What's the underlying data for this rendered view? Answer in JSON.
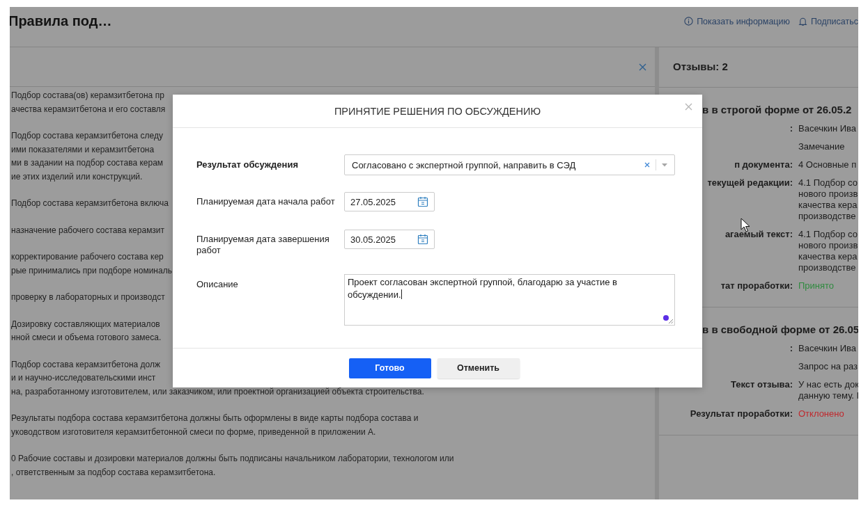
{
  "page": {
    "title": "Правила под…",
    "actions": [
      {
        "kind": "info",
        "label": "Показать информацию"
      },
      {
        "kind": "bell",
        "label": "Подписатьс"
      }
    ]
  },
  "document": {
    "paragraphs": [
      [
        "Подбор состава(ов) керамзитбетона пр",
        "ачества керамзитбетона и его составля"
      ],
      [
        "Подбор состава керамзитбетона следу",
        "ими показателями и керамзитбетона",
        "ми в задании на подбор состава керам",
        "ие этих изделий или конструкций."
      ],
      [
        "Подбор состава керамзитбетона включа"
      ],
      [
        "назначение рабочего состава керамзит"
      ],
      [
        "корректирование рабочего состава кер",
        "рые принимались при подборе номиналь"
      ],
      [
        "проверку в лабораторных и производст"
      ],
      [
        "Дозировку составляющих материалов",
        "нной смеси и объема готового замеса."
      ],
      [
        "Подбор состава керамзитбетона долж",
        "и и научно-исследовательскими инст",
        "на, разработанному изготовителем, или заказчиком, или проектной организацией объекта строительства."
      ],
      [
        "Результаты подбора состава керамзитбетона должны быть оформлены в виде карты подбора состава и",
        "уководством изготовителя керамзитбетонной смеси по форме, приведенной в приложении А."
      ],
      [
        "0 Рабочие составы и дозировки материалов должны быть подписаны начальником лаборатории, технологом или",
        ", ответственным за подбор состава керамзитбетона."
      ]
    ]
  },
  "reviews": {
    "title": "Отзывы: 2",
    "items": [
      {
        "heading": "в в строгой форме от 26.05.2",
        "fields": [
          {
            "label": ":",
            "value": [
              "Васечкин Ива"
            ]
          },
          {
            "value": [
              "Замечание"
            ]
          },
          {
            "label": "п документа:",
            "value": [
              "4 Основные п"
            ]
          },
          {
            "label": "текущей редакции:",
            "value": [
              "4.1 Подбор со",
              "нового произв",
              "качества кера",
              "производстве"
            ]
          },
          {
            "label": "агаемый текст:",
            "value": [
              "4.1 Подбор со",
              "нового произв",
              "качества кера",
              "производстве"
            ]
          },
          {
            "label": "тат проработки:",
            "value": [
              "Принято"
            ],
            "accepted": true
          }
        ]
      },
      {
        "heading": "в в свободной форме от 26.05",
        "fields": [
          {
            "label": ":",
            "value": [
              "Васечкин Ива"
            ]
          },
          {
            "value": [
              "Запрос на раз"
            ]
          },
          {
            "label": "Текст отзыва:",
            "value": [
              "У нас есть док",
              "данную тему. I"
            ]
          },
          {
            "label": "Результат проработки:",
            "value": [
              "Отклонено"
            ],
            "accepted": false
          }
        ]
      }
    ]
  },
  "dialog": {
    "title": "ПРИНЯТИЕ РЕШЕНИЯ ПО ОБСУЖДЕНИЮ",
    "fields": [
      {
        "kind": "select",
        "label": "Результат обсуждения",
        "emphasized": true,
        "value": "Согласовано с экспертной группой, направить в СЭД"
      },
      {
        "kind": "date",
        "label": "Планируемая дата начала работ",
        "emphasized": false,
        "value": "27.05.2025"
      },
      {
        "kind": "date",
        "label": "Планируемая дата завершения работ",
        "emphasized": false,
        "value": "30.05.2025"
      },
      {
        "kind": "textarea",
        "label": "Описание",
        "emphasized": false,
        "value": "Проект согласован экспертной группой, благодарю за участие в обсуждении."
      }
    ],
    "buttons": [
      {
        "kind": "primary",
        "label": "Готово"
      },
      {
        "kind": "secondary",
        "label": "Отменить"
      }
    ]
  }
}
